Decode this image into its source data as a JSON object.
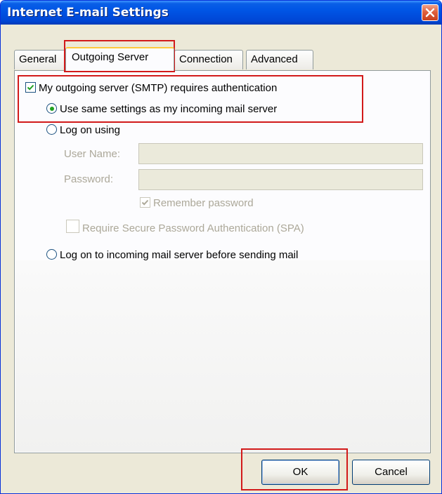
{
  "window": {
    "title": "Internet E-mail Settings",
    "close_icon": "close-icon"
  },
  "tabs": [
    {
      "label": "General",
      "active": false
    },
    {
      "label": "Outgoing Server",
      "active": true
    },
    {
      "label": "Connection",
      "active": false
    },
    {
      "label": "Advanced",
      "active": false
    }
  ],
  "outgoing": {
    "smtp_auth": {
      "label": "My outgoing server (SMTP) requires authentication",
      "checked": true
    },
    "use_same": {
      "label": "Use same settings as my incoming mail server",
      "selected": true
    },
    "log_on_using": {
      "label": "Log on using",
      "selected": false
    },
    "username": {
      "label": "User Name:",
      "value": ""
    },
    "password": {
      "label": "Password:",
      "value": ""
    },
    "remember_password": {
      "label": "Remember password",
      "checked": true,
      "disabled": true
    },
    "spa": {
      "label": "Require Secure Password Authentication (SPA)",
      "checked": false,
      "disabled": true
    },
    "log_on_incoming": {
      "label": "Log on to incoming mail server before sending mail",
      "selected": false
    }
  },
  "buttons": {
    "ok": "OK",
    "cancel": "Cancel"
  },
  "colors": {
    "highlight": "#d21a1a",
    "titlebar": "#0055e5",
    "radio_dot": "#21a121"
  }
}
